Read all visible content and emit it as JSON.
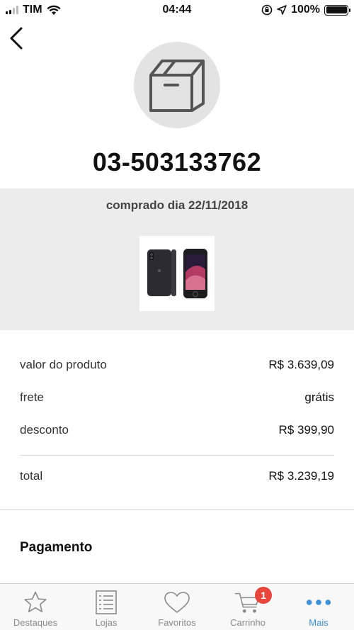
{
  "status_bar": {
    "carrier": "TIM",
    "time": "04:44",
    "battery": "100%"
  },
  "order": {
    "id": "03-503133762",
    "purchase_date": "comprado dia 22/11/2018"
  },
  "prices": [
    {
      "label": "valor do produto",
      "value": "R$ 3.639,09"
    },
    {
      "label": "frete",
      "value": "grátis"
    },
    {
      "label": "desconto",
      "value": "R$ 399,90"
    }
  ],
  "total": {
    "label": "total",
    "value": "R$ 3.239,19"
  },
  "payment": {
    "title": "Pagamento"
  },
  "tabs": [
    {
      "label": "Destaques",
      "icon": "star-icon"
    },
    {
      "label": "Lojas",
      "icon": "list-icon"
    },
    {
      "label": "Favoritos",
      "icon": "heart-icon"
    },
    {
      "label": "Carrinho",
      "icon": "cart-icon",
      "badge": "1"
    },
    {
      "label": "Mais",
      "icon": "more-icon",
      "active": true
    }
  ],
  "colors": {
    "accent": "#3d8fd8",
    "badge": "#e8453c"
  }
}
